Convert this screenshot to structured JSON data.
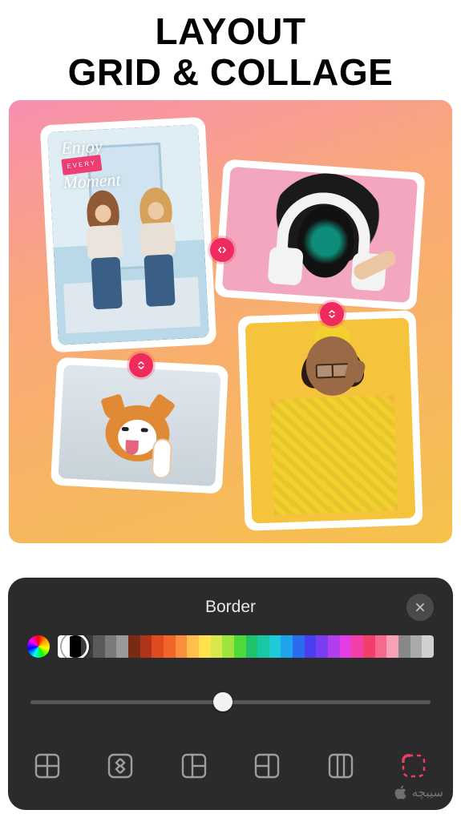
{
  "headline_line1": "LAYOUT",
  "headline_line2": "GRID & COLLAGE",
  "sticker": {
    "line1": "Enjoy",
    "ribbon": "EVERY",
    "line2": "Moment"
  },
  "panel": {
    "title": "Border",
    "slider_value": 0.48,
    "selected_swatch_index": 1
  },
  "swatches": [
    "#ffffff",
    "#000000",
    "#3a3a3a",
    "#5a5a5a",
    "#7a7a7a",
    "#9a9a9a",
    "#7a2a14",
    "#b0341a",
    "#e04a1f",
    "#f2652a",
    "#f98f3a",
    "#ffbf4a",
    "#ffe24e",
    "#d8e84a",
    "#9de43e",
    "#4fd83a",
    "#1fc26a",
    "#18c7a6",
    "#1ccad8",
    "#1fa4ea",
    "#2a6cf0",
    "#4a3ef0",
    "#7a3ef0",
    "#b23ef0",
    "#e23ee2",
    "#f23ea8",
    "#f23e6c",
    "#f56a8c",
    "#f8a0b8",
    "#888888",
    "#aaaaaa",
    "#d0d0d0"
  ],
  "tools": [
    {
      "id": "grid-2x2",
      "name": "layout-grid-icon"
    },
    {
      "id": "spacing",
      "name": "layout-spacing-icon"
    },
    {
      "id": "split-a",
      "name": "layout-split-a-icon"
    },
    {
      "id": "split-b",
      "name": "layout-split-b-icon"
    },
    {
      "id": "split-c",
      "name": "layout-split-c-icon"
    },
    {
      "id": "border",
      "name": "layout-border-icon",
      "active": true
    }
  ],
  "watermark": "سیبچه"
}
